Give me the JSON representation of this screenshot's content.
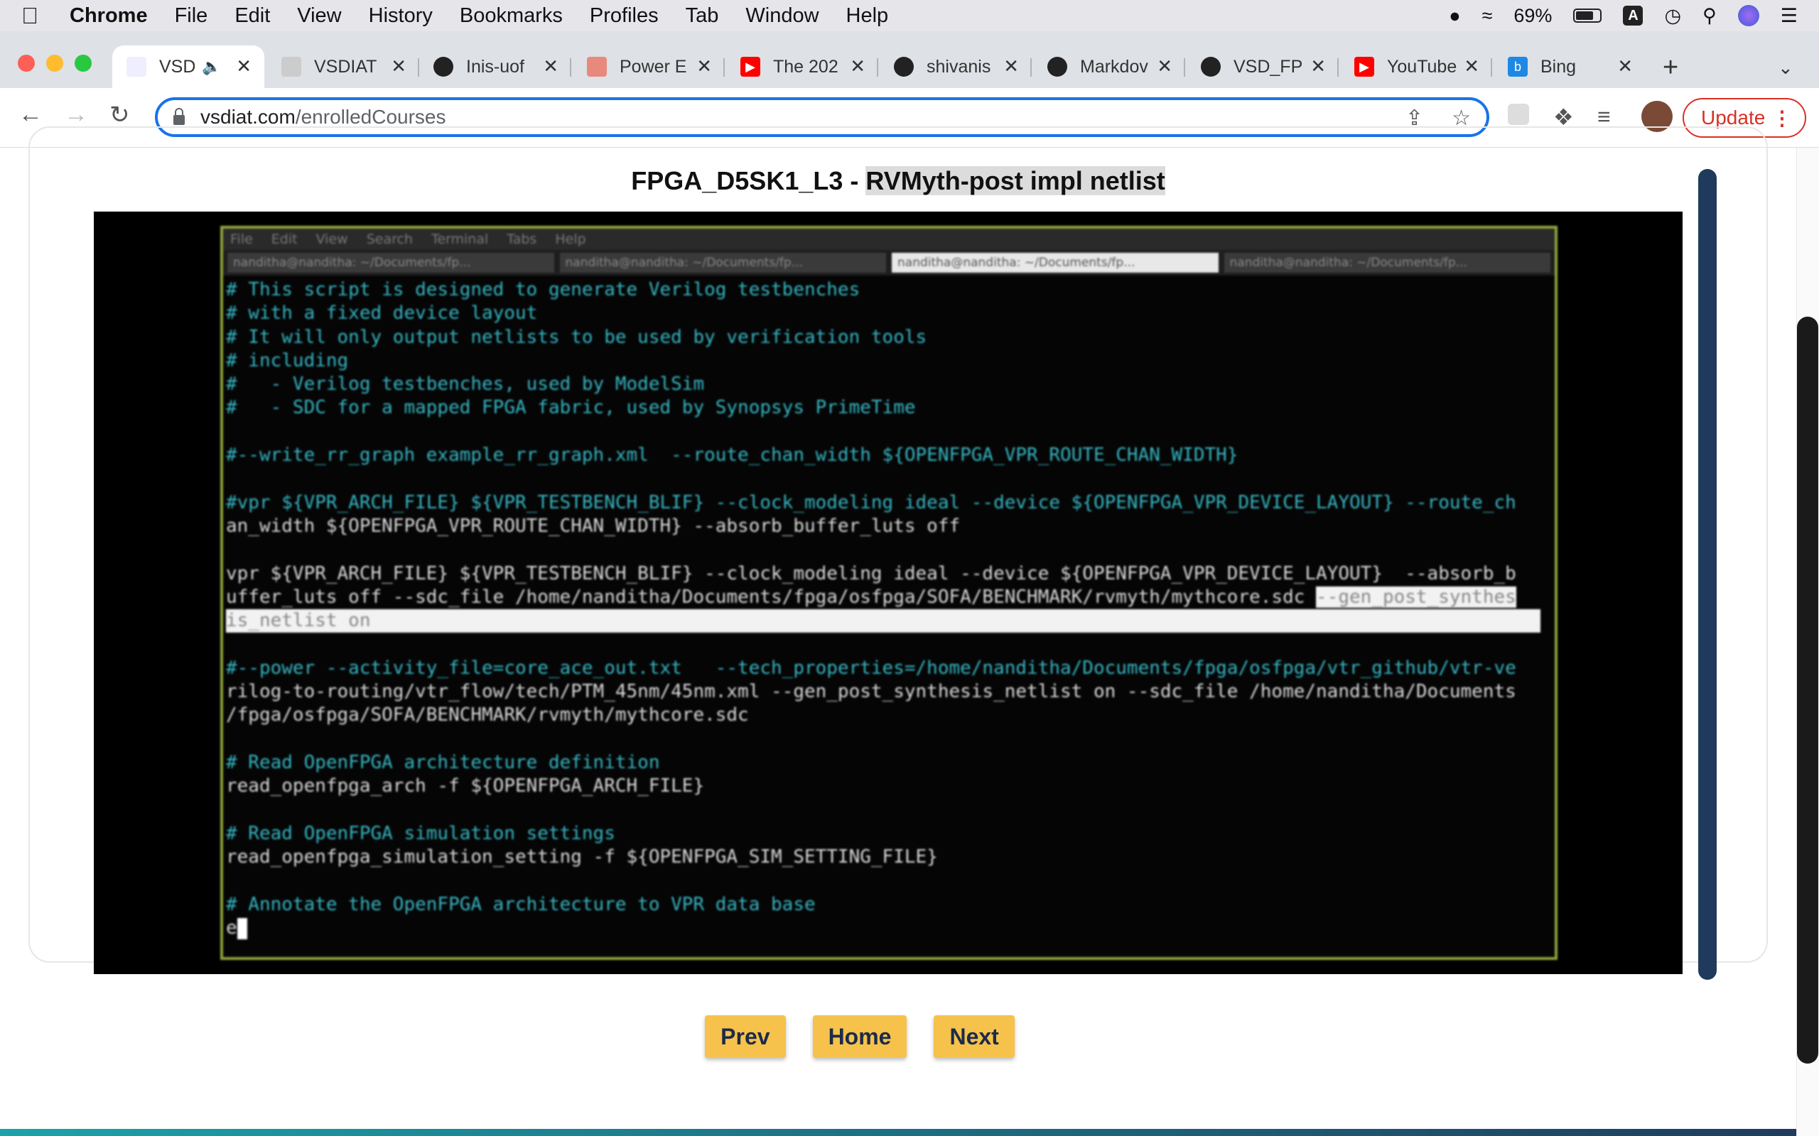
{
  "menubar": {
    "app": "Chrome",
    "items": [
      "File",
      "Edit",
      "View",
      "History",
      "Bookmarks",
      "Profiles",
      "Tab",
      "Window",
      "Help"
    ],
    "battery": "69%",
    "input_badge": "A"
  },
  "tabs": [
    {
      "label": "VSD",
      "favicon": "vsd-icon"
    },
    {
      "label": "VSDIAT",
      "favicon": "vsdiat-icon"
    },
    {
      "label": "Inis-uof",
      "favicon": "github-icon"
    },
    {
      "label": "Power E",
      "favicon": "power-icon"
    },
    {
      "label": "The 202",
      "favicon": "youtube-icon"
    },
    {
      "label": "shivanis",
      "favicon": "github-icon"
    },
    {
      "label": "Markdov",
      "favicon": "github-icon"
    },
    {
      "label": "VSD_FP",
      "favicon": "github-icon"
    },
    {
      "label": "YouTube",
      "favicon": "youtube-icon"
    },
    {
      "label": "Bing",
      "favicon": "bing-icon"
    }
  ],
  "address": {
    "domain": "vsdiat.com",
    "path": "/enrolledCourses"
  },
  "toolbar": {
    "update_label": "Update"
  },
  "lesson": {
    "code": "FPGA_D5SK1_L3 - ",
    "title": "RVMyth-post impl netlist"
  },
  "terminal": {
    "menu": [
      "File",
      "Edit",
      "View",
      "Search",
      "Terminal",
      "Tabs",
      "Help"
    ],
    "tabs": [
      "nanditha@nanditha: ~/Documents/fp...",
      "nanditha@nanditha: ~/Documents/fp...",
      "nanditha@nanditha: ~/Documents/fp...",
      "nanditha@nanditha: ~/Documents/fp..."
    ],
    "lines": [
      "# This script is designed to generate Verilog testbenches",
      "# with a fixed device layout",
      "# It will only output netlists to be used by verification tools",
      "# including",
      "#   - Verilog testbenches, used by ModelSim",
      "#   - SDC for a mapped FPGA fabric, used by Synopsys PrimeTime",
      "",
      "#--write_rr_graph example_rr_graph.xml  --route_chan_width ${OPENFPGA_VPR_ROUTE_CHAN_WIDTH}",
      "",
      "#vpr ${VPR_ARCH_FILE} ${VPR_TESTBENCH_BLIF} --clock_modeling ideal --device ${OPENFPGA_VPR_DEVICE_LAYOUT} --route_ch",
      "an_width ${OPENFPGA_VPR_ROUTE_CHAN_WIDTH} --absorb_buffer_luts off",
      "",
      "vpr ${VPR_ARCH_FILE} ${VPR_TESTBENCH_BLIF} --clock_modeling ideal --device ${OPENFPGA_VPR_DEVICE_LAYOUT}  --absorb_b",
      "uffer_luts off --sdc_file /home/nanditha/Documents/fpga/osfpga/SOFA/BENCHMARK/rvmyth/mythcore.sdc --gen_post_synthes",
      "is_netlist on",
      "",
      "#--power --activity_file=core_ace_out.txt   --tech_properties=/home/nanditha/Documents/fpga/osfpga/vtr_github/vtr-ve",
      "rilog-to-routing/vtr_flow/tech/PTM_45nm/45nm.xml --gen_post_synthesis_netlist on --sdc_file /home/nanditha/Documents",
      "/fpga/osfpga/SOFA/BENCHMARK/rvmyth/mythcore.sdc",
      "",
      "# Read OpenFPGA architecture definition",
      "read_openfpga_arch -f ${OPENFPGA_ARCH_FILE}",
      "",
      "# Read OpenFPGA simulation settings",
      "read_openfpga_simulation_setting -f ${OPENFPGA_SIM_SETTING_FILE}",
      "",
      "# Annotate the OpenFPGA architecture to VPR data base",
      "e"
    ]
  },
  "nav": {
    "prev": "Prev",
    "home": "Home",
    "next": "Next"
  }
}
